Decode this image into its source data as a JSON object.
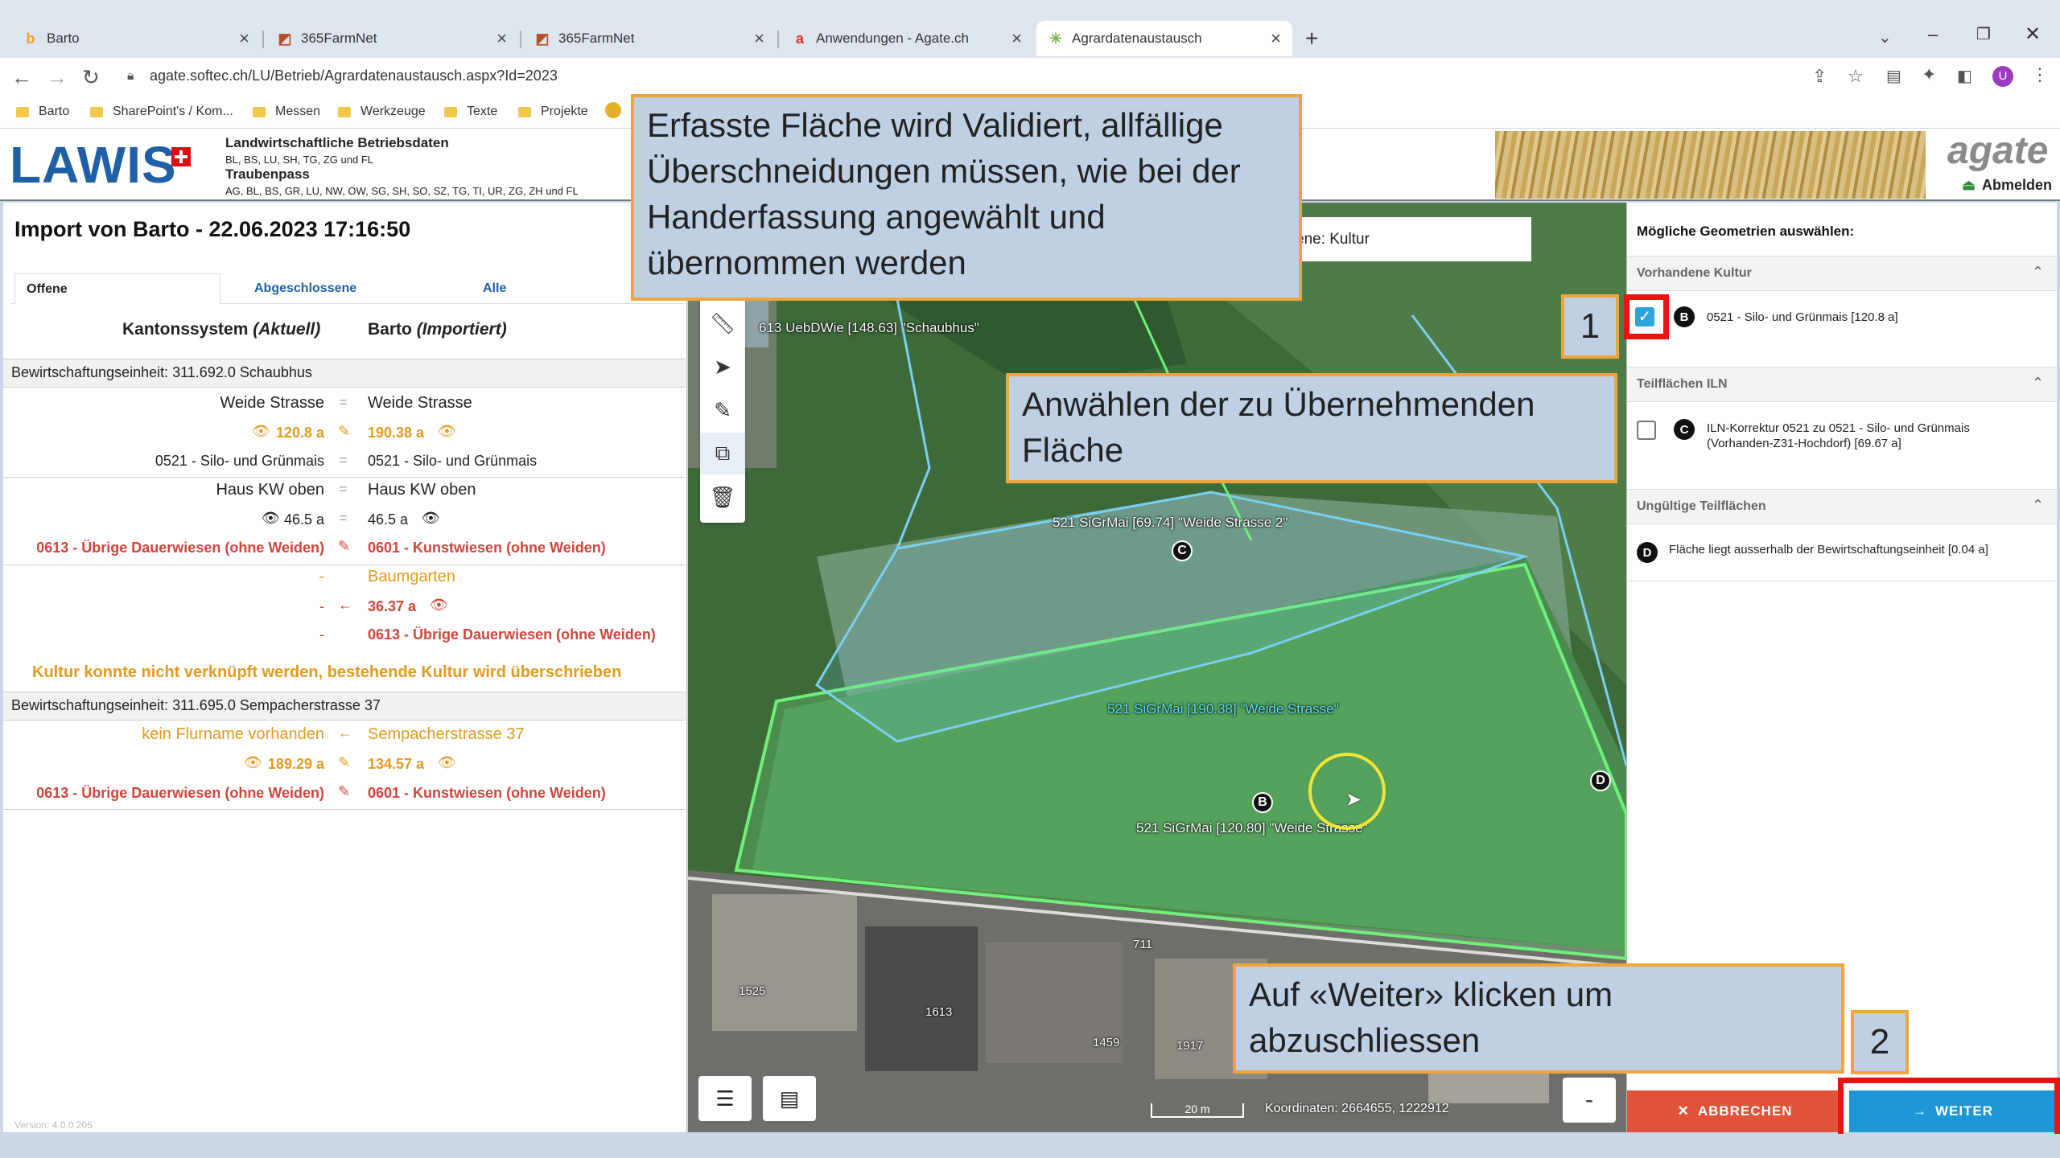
{
  "browser": {
    "tabs": [
      {
        "title": "Barto",
        "icon": "b"
      },
      {
        "title": "365FarmNet",
        "icon": "farm"
      },
      {
        "title": "365FarmNet",
        "icon": "farm"
      },
      {
        "title": "Anwendungen - Agate.ch",
        "icon": "a"
      },
      {
        "title": "Agrardatenaustausch",
        "icon": "gear"
      }
    ],
    "new_tab": "+",
    "url": "agate.softec.ch/LU/Betrieb/Agrardatenaustausch.aspx?Id=2023",
    "bookmarks": [
      "Barto",
      "SharePoint's / Kom...",
      "Messen",
      "Werkzeuge",
      "Texte",
      "Projekte"
    ],
    "avatar": "U"
  },
  "header": {
    "logo": "LAWIS",
    "line1": "Landwirtschaftliche Betriebsdaten",
    "line2": "BL, BS, LU, SH, TG, ZG und FL",
    "line3": "Traubenpass",
    "line4": "AG, BL, BS, GR, LU, NW, OW, SG, SH, SO, SZ, TG, TI, UR, ZG, ZH und FL",
    "agate_logo": "agate",
    "logout": "Abmelden"
  },
  "left": {
    "title": "Import von Barto - 22.06.2023 17:16:50",
    "tabs": [
      "Offene",
      "Abgeschlossene",
      "Alle"
    ],
    "col_left": "Kantonssystem",
    "col_left_em": "(Aktuell)",
    "col_right": "Barto",
    "col_right_em": "(Importiert)",
    "unit1": "Bewirtschaftungseinheit: 311.692.0 Schaubhus",
    "r1_left": "Weide Strasse",
    "r1_right": "Weide Strasse",
    "r2_left": "120.8 a",
    "r2_right": "190.38 a",
    "r3_left": "0521 - Silo- und Grünmais",
    "r3_right": "0521 - Silo- und Grünmais",
    "r4_left": "Haus KW oben",
    "r4_right": "Haus KW oben",
    "r5_left": "46.5 a",
    "r5_right": "46.5 a",
    "r6_left": "0613 - Übrige Dauerwiesen (ohne Weiden)",
    "r6_right": "0601 - Kunstwiesen (ohne Weiden)",
    "r7_left": "-",
    "r7_right": "Baumgarten",
    "r8_left": "-",
    "r8_right": "36.37 a",
    "r9_left": "-",
    "r9_right": "0613 - Übrige Dauerwiesen (ohne Weiden)",
    "warning": "Kultur konnte nicht verknüpft werden, bestehende Kultur wird überschrieben",
    "unit2": "Bewirtschaftungseinheit: 311.695.0 Sempacherstrasse 37",
    "r10_left": "kein Flurname vorhanden",
    "r10_right": "Sempacherstrasse 37",
    "r11_left": "189.29 a",
    "r11_right": "134.57 a",
    "r12_left": "0613 - Übrige Dauerwiesen (ohne Weiden)",
    "r12_right": "0601 - Kunstwiesen (ohne Weiden)",
    "version": "Version: 4.0.0.205"
  },
  "map": {
    "layer_box": "ene: Kultur",
    "labels": {
      "l1": "613 UebDWie [148.63] \"Schaubhus\"",
      "l2": "521 SiGrMai [69.74] \"Weide Strasse 2\"",
      "l3": "521 SiGrMai [190.38] \"Weide Strasse\"",
      "l4": "521 SiGrMai [120.80] \"Weide Strasse\"",
      "n711": "711",
      "n1525": "1525",
      "n1613": "1613",
      "n1459": "1459",
      "n1917": "1917"
    },
    "markers": {
      "b": "B",
      "c": "C",
      "d": "D"
    },
    "scale": "20 m",
    "coords": "Koordinaten: 2664655, 1222912",
    "minus": "-"
  },
  "right": {
    "title": "Mögliche Geometrien auswählen:",
    "sec1": "Vorhandene Kultur",
    "item1_badge": "B",
    "item1": "0521 - Silo- und Grünmais [120.8 a]",
    "item1_checked": true,
    "sec2": "Teilflächen ILN",
    "item2_badge": "C",
    "item2_line1": "ILN-Korrektur 0521 zu 0521 - Silo- und Grünmais",
    "item2_line2": "(Vorhanden-Z31-Hochdorf) [69.67 a]",
    "item2_checked": false,
    "sec3": "Ungültige Teilflächen",
    "item3_badge": "D",
    "item3": "Fläche liegt ausserhalb der Bewirtschaftungseinheit [0.04 a]",
    "cancel": "ABBRECHEN",
    "next": "WEITER"
  },
  "callouts": {
    "c1": "Erfasste Fläche wird Validiert, allfällige Überschneidungen müssen, wie bei der Handerfassung angewählt und übernommen werden",
    "c2": "Anwählen der zu Übernehmenden Fläche",
    "c3": "Auf «Weiter» klicken um abzuschliessen",
    "n1": "1",
    "n2": "2"
  },
  "colors": {
    "accent_blue": "#1d97d6",
    "cancel_red": "#e0533a",
    "callout_bg": "#bfcfe4",
    "callout_border": "#f0a53a",
    "highlight_red": "#ef1010",
    "field_green": "#5fcf7a"
  }
}
